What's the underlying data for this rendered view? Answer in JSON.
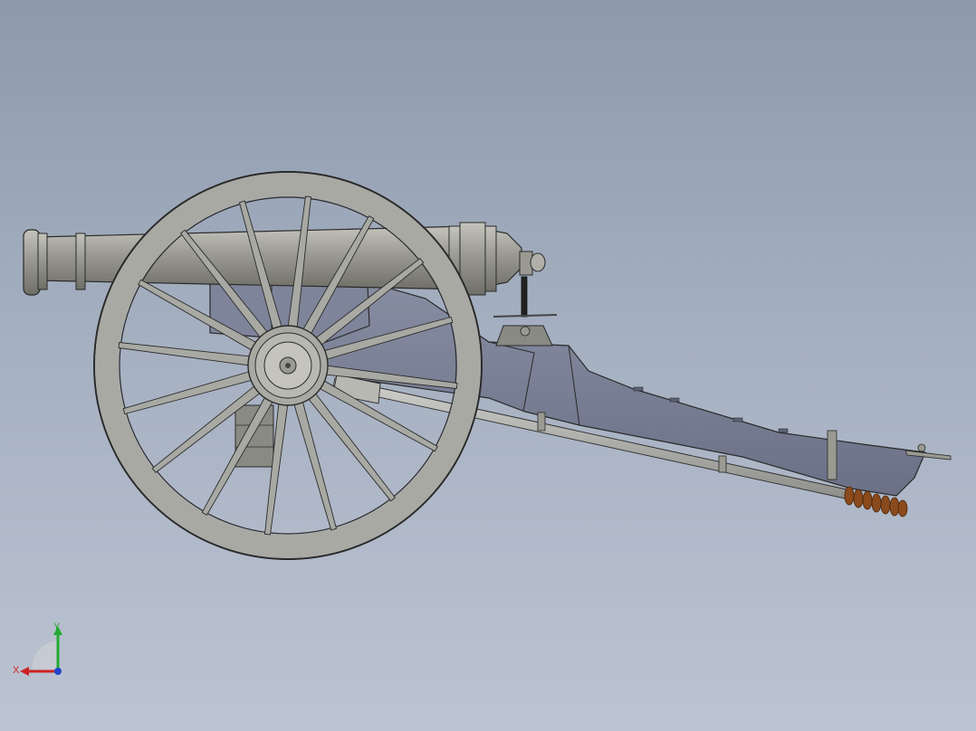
{
  "viewport": {
    "background_top": "#8e9aac",
    "background_bottom": "#bcc4d2"
  },
  "model": {
    "colors": {
      "metal": "#9a9a92",
      "metal_dark": "#6f6f68",
      "carriage": "#7e859a",
      "carriage_dark": "#5d6478",
      "wheel": "#a9a9a4",
      "outline": "#2a2a2a",
      "spring": "#8a4a1c"
    },
    "wheel_spokes": 16
  },
  "triad": {
    "x_label": "X",
    "y_label": "Y",
    "x_color": "#cc2222",
    "y_color": "#22aa33",
    "z_color": "#2244cc"
  }
}
